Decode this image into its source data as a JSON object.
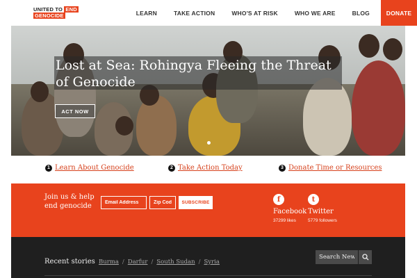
{
  "logo": {
    "line1": "UNITED TO",
    "line1_red": "END",
    "line2": "GENOCIDE"
  },
  "nav": {
    "items": [
      "LEARN",
      "TAKE ACTION",
      "WHO'S AT RISK",
      "WHO WE ARE",
      "BLOG"
    ],
    "donate": "DONATE"
  },
  "hero": {
    "title": "Lost at Sea: Rohingya Fleeing the Threat of Genocide",
    "cta": "ACT NOW"
  },
  "steps": [
    {
      "num": "1",
      "label": "Learn About Genocide"
    },
    {
      "num": "2",
      "label": "Take Action Today"
    },
    {
      "num": "3",
      "label": "Donate Time or Resources"
    }
  ],
  "signup": {
    "text": "Join us & help end genocide",
    "email_placeholder": "Email Address",
    "zip_placeholder": "Zip Code",
    "subscribe": "SUBSCRIBE"
  },
  "social": {
    "facebook": {
      "icon": "f",
      "name": "Facebook",
      "count": "37299 likes"
    },
    "twitter": {
      "icon": "t",
      "name": "Twitter",
      "count": "5779 followers"
    }
  },
  "footer": {
    "recent_label": "Recent stories",
    "tags": [
      "Burma",
      "Darfur",
      "South Sudan",
      "Syria"
    ],
    "search_placeholder": "Search News"
  },
  "colors": {
    "accent": "#e8431d",
    "dark": "#1f1f1f"
  }
}
